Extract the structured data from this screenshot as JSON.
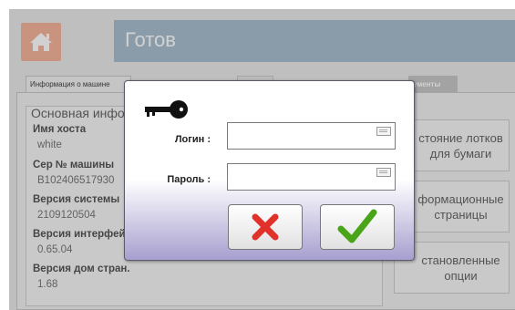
{
  "header": {
    "title": "Готов"
  },
  "tabs": [
    {
      "label": "Информация о машине"
    },
    {
      "label": ""
    },
    {
      "label": "ументы"
    }
  ],
  "info": {
    "heading": "Основная информация",
    "items": [
      {
        "label": "Имя хоста",
        "value": "white"
      },
      {
        "label": "Сер № машины",
        "value": "B102406517930"
      },
      {
        "label": "Версия системы",
        "value": "2109120504"
      },
      {
        "label": "Версия интерфейса",
        "value": "0.65.04"
      },
      {
        "label": "Версия дом стран.",
        "value": "1.68"
      }
    ]
  },
  "side_buttons": [
    {
      "line1": "стояние лотков",
      "line2": "для бумаги"
    },
    {
      "line1": "формационные",
      "line2": "страницы"
    },
    {
      "line1": "становленные",
      "line2": "опции"
    }
  ],
  "dialog": {
    "login_label": "Логин :",
    "login_value": "",
    "password_label": "Пароль :",
    "password_value": ""
  },
  "colors": {
    "cancel": "#e0312b",
    "ok": "#49a517",
    "header": "#a9bfd0",
    "home": "#f4b59c"
  },
  "icons": {
    "home": "home-icon",
    "key": "key-icon",
    "cancel": "x-icon",
    "ok": "checkmark-icon"
  }
}
